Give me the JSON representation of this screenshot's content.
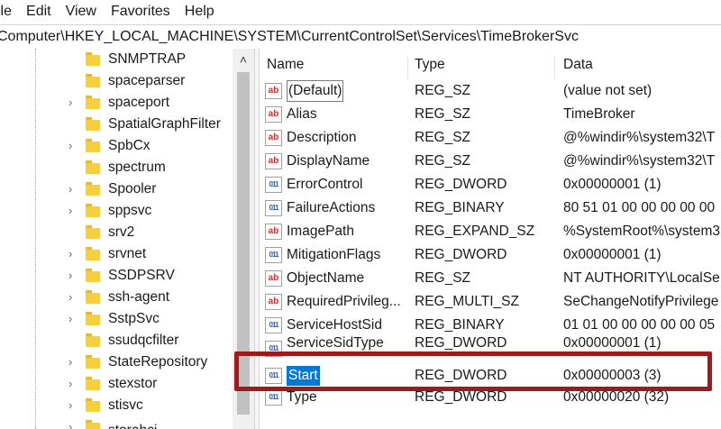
{
  "window": {
    "menu": [
      "ile",
      "Edit",
      "View",
      "Favorites",
      "Help"
    ],
    "address": "Computer\\HKEY_LOCAL_MACHINE\\SYSTEM\\CurrentControlSet\\Services\\TimeBrokerSvc"
  },
  "tree": {
    "items": [
      {
        "label": "SNMPTRAP",
        "expandable": false
      },
      {
        "label": "spaceparser",
        "expandable": false
      },
      {
        "label": "spaceport",
        "expandable": true
      },
      {
        "label": "SpatialGraphFilter",
        "expandable": false
      },
      {
        "label": "SpbCx",
        "expandable": true
      },
      {
        "label": "spectrum",
        "expandable": false
      },
      {
        "label": "Spooler",
        "expandable": true
      },
      {
        "label": "sppsvc",
        "expandable": true
      },
      {
        "label": "srv2",
        "expandable": false
      },
      {
        "label": "srvnet",
        "expandable": true
      },
      {
        "label": "SSDPSRV",
        "expandable": true
      },
      {
        "label": "ssh-agent",
        "expandable": true
      },
      {
        "label": "SstpSvc",
        "expandable": true
      },
      {
        "label": "ssudqcfilter",
        "expandable": false
      },
      {
        "label": "StateRepository",
        "expandable": true
      },
      {
        "label": "stexstor",
        "expandable": true
      },
      {
        "label": "stisvc",
        "expandable": true
      },
      {
        "label": "storahci",
        "expandable": true
      }
    ]
  },
  "list": {
    "columns": [
      "Name",
      "Type",
      "Data"
    ],
    "rows": [
      {
        "icon": "string-value-icon",
        "name": "(Default)",
        "type": "REG_SZ",
        "data": "(value not set)"
      },
      {
        "icon": "string-value-icon",
        "name": "Alias",
        "type": "REG_SZ",
        "data": "TimeBroker"
      },
      {
        "icon": "string-value-icon",
        "name": "Description",
        "type": "REG_SZ",
        "data": "@%windir%\\system32\\T"
      },
      {
        "icon": "string-value-icon",
        "name": "DisplayName",
        "type": "REG_SZ",
        "data": "@%windir%\\system32\\T"
      },
      {
        "icon": "binary-value-icon",
        "name": "ErrorControl",
        "type": "REG_DWORD",
        "data": "0x00000001 (1)"
      },
      {
        "icon": "binary-value-icon",
        "name": "FailureActions",
        "type": "REG_BINARY",
        "data": "80 51 01 00 00 00 00 00"
      },
      {
        "icon": "string-value-icon",
        "name": "ImagePath",
        "type": "REG_EXPAND_SZ",
        "data": "%SystemRoot%\\system3"
      },
      {
        "icon": "binary-value-icon",
        "name": "MitigationFlags",
        "type": "REG_DWORD",
        "data": "0x00000001 (1)"
      },
      {
        "icon": "string-value-icon",
        "name": "ObjectName",
        "type": "REG_SZ",
        "data": "NT AUTHORITY\\LocalSe"
      },
      {
        "icon": "string-value-icon",
        "name": "RequiredPrivileg...",
        "type": "REG_MULTI_SZ",
        "data": "SeChangeNotifyPrivilege"
      },
      {
        "icon": "binary-value-icon",
        "name": "ServiceHostSid",
        "type": "REG_BINARY",
        "data": "01 01 00 00 00 00 00 05"
      },
      {
        "icon": "binary-value-icon",
        "name": "ServiceSidType",
        "type": "REG_DWORD",
        "data": "0x00000001 (1)"
      },
      {
        "icon": "binary-value-icon",
        "name": "Start",
        "type": "REG_DWORD",
        "data": "0x00000003 (3)"
      },
      {
        "icon": "binary-value-icon",
        "name": "Type",
        "type": "REG_DWORD",
        "data": "0x00000020 (32)"
      }
    ]
  },
  "highlight": {
    "color": "#9e1b1b"
  },
  "selection": {
    "color": "#0078d7"
  }
}
